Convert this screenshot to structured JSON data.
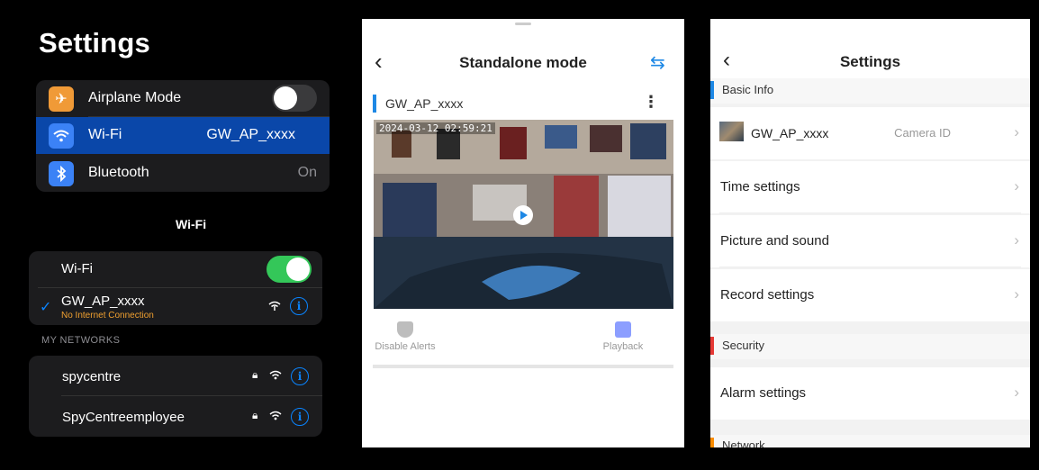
{
  "ios": {
    "title": "Settings",
    "rows": [
      {
        "label": "Airplane Mode",
        "icon": "airplane-icon",
        "icon_color": "#f09a37"
      },
      {
        "label": "Wi-Fi",
        "value": "GW_AP_xxxx",
        "icon": "wifi-icon",
        "icon_color": "#3b82f6"
      },
      {
        "label": "Bluetooth",
        "value": "On",
        "icon": "bluetooth-icon",
        "icon_color": "#3b82f6"
      }
    ],
    "wifi_header": "Wi-Fi",
    "wifi_toggle_label": "Wi-Fi",
    "connected": {
      "name": "GW_AP_xxxx",
      "status": "No Internet Connection",
      "status_color": "#f0a030"
    },
    "networks_label": "MY NETWORKS",
    "networks": [
      {
        "name": "spycentre"
      },
      {
        "name": "SpyCentreemployee"
      }
    ],
    "colors": {
      "accent": "#0a84ff",
      "toggle_on": "#34c759",
      "selected_row": "#0a47a9"
    }
  },
  "standalone": {
    "title": "Standalone mode",
    "camera_name": "GW_AP_xxxx",
    "timestamp": "2024-03-12  02:59:21",
    "actions": [
      {
        "label": "Disable Alerts",
        "icon": "shield-icon"
      },
      {
        "label": "Playback",
        "icon": "playback-icon"
      }
    ],
    "accent": "#1e88e5"
  },
  "camera_settings": {
    "title": "Settings",
    "sections": {
      "basic_info": "Basic Info",
      "security": "Security",
      "network": "Network"
    },
    "camera_row": {
      "name": "GW_AP_xxxx",
      "sub": "Camera ID"
    },
    "items": {
      "time": "Time settings",
      "picture": "Picture and sound",
      "record": "Record settings",
      "alarm": "Alarm settings"
    },
    "accents": {
      "basic_info": "#1e88e5",
      "security": "#e53935",
      "network": "#fb8c00"
    }
  }
}
